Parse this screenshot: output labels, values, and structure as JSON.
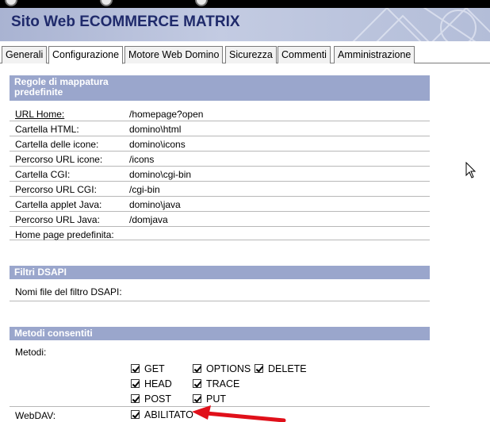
{
  "banner": {
    "title": "Sito Web ECOMMERCE MATRIX"
  },
  "tabs": [
    {
      "label": "Generali",
      "active": false
    },
    {
      "label": "Configurazione",
      "active": true
    },
    {
      "label": "Motore Web Domino",
      "active": false
    },
    {
      "label": "Sicurezza",
      "active": false
    },
    {
      "label": "Commenti",
      "active": false
    },
    {
      "label": "Amministrazione",
      "active": false
    }
  ],
  "mapping": {
    "header": "Regole di mappatura predefinite",
    "rows": [
      {
        "label": "URL Home:",
        "value": "/homepage?open"
      },
      {
        "label": "Cartella HTML:",
        "value": "domino\\html"
      },
      {
        "label": "Cartella delle icone:",
        "value": "domino\\icons"
      },
      {
        "label": "Percorso URL icone:",
        "value": "/icons"
      },
      {
        "label": "Cartella CGI:",
        "value": "domino\\cgi-bin"
      },
      {
        "label": "Percorso URL CGI:",
        "value": "/cgi-bin"
      },
      {
        "label": "Cartella applet Java:",
        "value": "domino\\java"
      },
      {
        "label": "Percorso URL Java:",
        "value": "/domjava"
      },
      {
        "label": "Home page predefinita:",
        "value": ""
      }
    ]
  },
  "dsapi": {
    "header": "Filtri DSAPI",
    "rows": [
      {
        "label": "Nomi file del filtro DSAPI:",
        "value": ""
      }
    ]
  },
  "methods": {
    "header": "Metodi consentiti",
    "label": "Metodi:",
    "options": [
      {
        "label": "GET",
        "checked": true
      },
      {
        "label": "OPTIONS",
        "checked": true
      },
      {
        "label": "DELETE",
        "checked": true
      },
      {
        "label": "HEAD",
        "checked": true
      },
      {
        "label": "TRACE",
        "checked": true
      },
      {
        "label": "POST",
        "checked": true
      },
      {
        "label": "PUT",
        "checked": true
      }
    ],
    "webdav_label": "WebDAV:",
    "webdav_option": {
      "label": "ABILITATO",
      "checked": true
    }
  },
  "colors": {
    "section_header": "#9aa6cc",
    "banner_title": "#1f2a6b",
    "arrow": "#e0101a"
  }
}
